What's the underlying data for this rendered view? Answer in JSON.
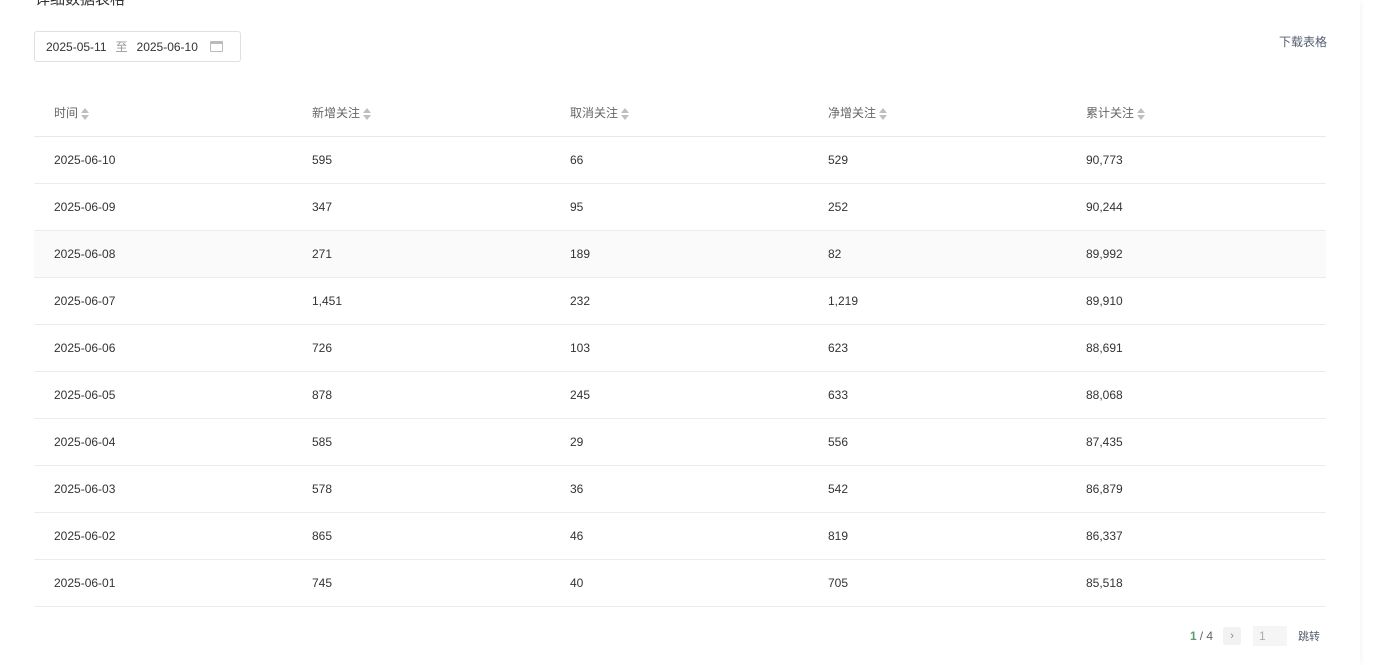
{
  "section_title": "详细数据表格",
  "date_range": {
    "start": "2025-05-11",
    "separator": "至",
    "end": "2025-06-10"
  },
  "download_label": "下载表格",
  "table": {
    "headers": [
      "时间",
      "新增关注",
      "取消关注",
      "净增关注",
      "累计关注"
    ],
    "rows": [
      [
        "2025-06-10",
        "595",
        "66",
        "529",
        "90,773"
      ],
      [
        "2025-06-09",
        "347",
        "95",
        "252",
        "90,244"
      ],
      [
        "2025-06-08",
        "271",
        "189",
        "82",
        "89,992"
      ],
      [
        "2025-06-07",
        "1,451",
        "232",
        "1,219",
        "89,910"
      ],
      [
        "2025-06-06",
        "726",
        "103",
        "623",
        "88,691"
      ],
      [
        "2025-06-05",
        "878",
        "245",
        "633",
        "88,068"
      ],
      [
        "2025-06-04",
        "585",
        "29",
        "556",
        "87,435"
      ],
      [
        "2025-06-03",
        "578",
        "36",
        "542",
        "86,879"
      ],
      [
        "2025-06-02",
        "865",
        "46",
        "819",
        "86,337"
      ],
      [
        "2025-06-01",
        "745",
        "40",
        "705",
        "85,518"
      ]
    ]
  },
  "pagination": {
    "current": "1",
    "total": "/ 4",
    "next_icon": "chevron-right-icon",
    "jump_input_value": "1",
    "jump_label": "跳转"
  }
}
